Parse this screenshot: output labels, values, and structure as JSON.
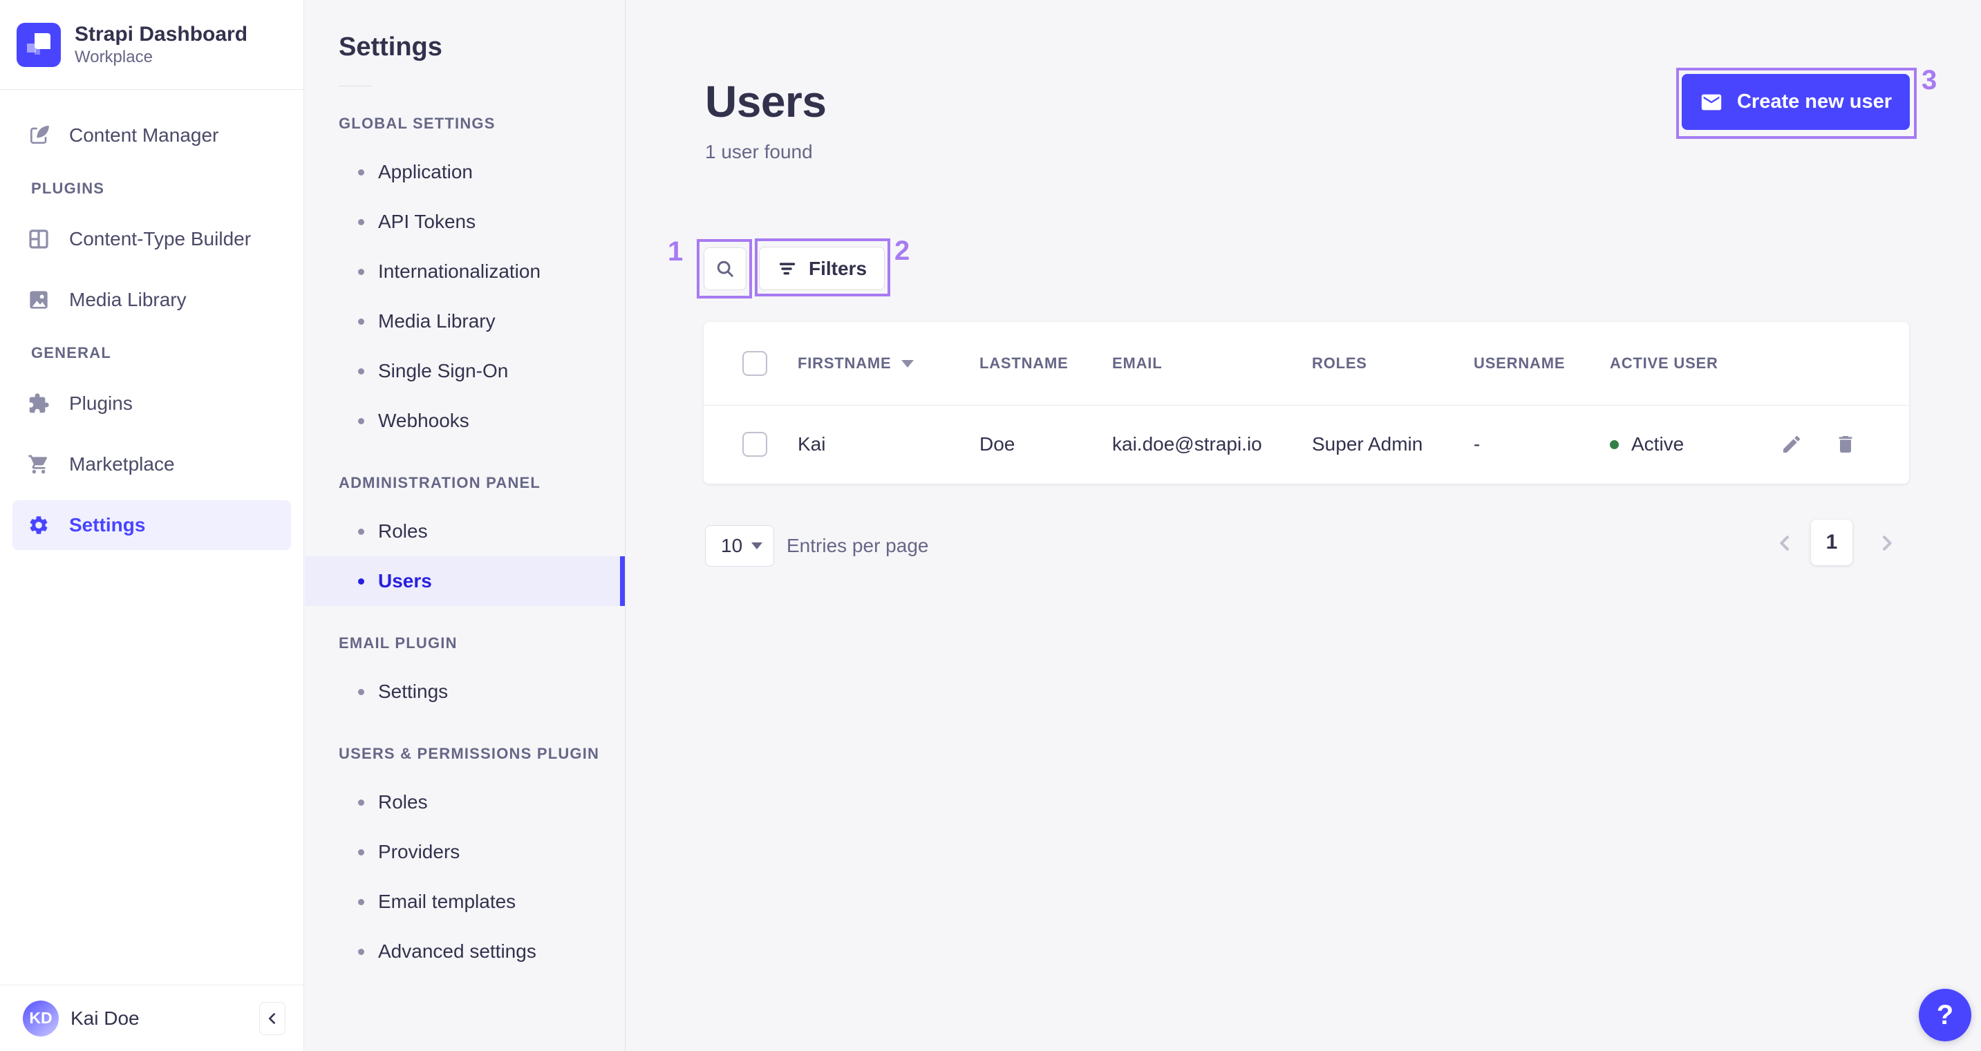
{
  "brand": {
    "title": "Strapi Dashboard",
    "subtitle": "Workplace"
  },
  "nav": {
    "content_manager": {
      "label": "Content Manager"
    },
    "sections": [
      {
        "label": "PLUGINS",
        "items": [
          {
            "label": "Content-Type Builder"
          },
          {
            "label": "Media Library"
          }
        ]
      },
      {
        "label": "GENERAL",
        "items": [
          {
            "label": "Plugins"
          },
          {
            "label": "Marketplace"
          },
          {
            "label": "Settings",
            "active": true
          }
        ]
      }
    ],
    "user": {
      "initials": "KD",
      "name": "Kai Doe"
    }
  },
  "settings_nav": {
    "title": "Settings",
    "sections": [
      {
        "label": "GLOBAL SETTINGS",
        "items": [
          {
            "label": "Application"
          },
          {
            "label": "API Tokens"
          },
          {
            "label": "Internationalization"
          },
          {
            "label": "Media Library"
          },
          {
            "label": "Single Sign-On"
          },
          {
            "label": "Webhooks"
          }
        ]
      },
      {
        "label": "ADMINISTRATION PANEL",
        "items": [
          {
            "label": "Roles"
          },
          {
            "label": "Users",
            "active": true
          }
        ]
      },
      {
        "label": "EMAIL PLUGIN",
        "items": [
          {
            "label": "Settings"
          }
        ]
      },
      {
        "label": "USERS & PERMISSIONS PLUGIN",
        "items": [
          {
            "label": "Roles"
          },
          {
            "label": "Providers"
          },
          {
            "label": "Email templates"
          },
          {
            "label": "Advanced settings"
          }
        ]
      }
    ]
  },
  "main": {
    "title": "Users",
    "subtitle": "1 user found",
    "create_button_label": "Create new user",
    "filters_button_label": "Filters",
    "table": {
      "headers": [
        "FIRSTNAME",
        "LASTNAME",
        "EMAIL",
        "ROLES",
        "USERNAME",
        "ACTIVE USER"
      ],
      "rows": [
        {
          "firstname": "Kai",
          "lastname": "Doe",
          "email": "kai.doe@strapi.io",
          "roles": "Super Admin",
          "username": "-",
          "status": "Active"
        }
      ]
    },
    "pagination": {
      "page_size": "10",
      "entries_label": "Entries per page",
      "current_page": "1"
    }
  },
  "help": {
    "label": "?"
  },
  "annotations": {
    "box1": "1",
    "box2": "2",
    "box3": "3"
  },
  "colors": {
    "accent": "#4945FF",
    "active_text": "#271FE0",
    "annotation": "#A77BF2",
    "success": "#328048"
  }
}
